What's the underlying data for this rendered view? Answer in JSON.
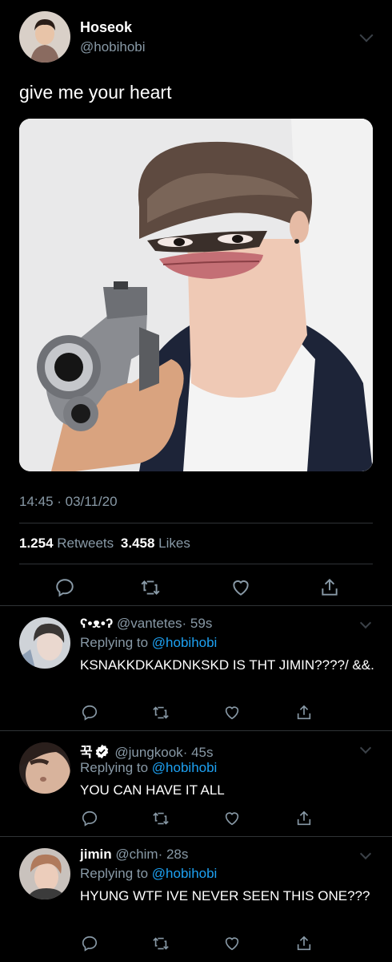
{
  "tweet": {
    "name": "Hoseok",
    "handle": "@hobihobi",
    "text": "give me your heart",
    "timestamp": "14:45 · 03/11/20",
    "retweets_count": "1.254",
    "retweets_label": "Retweets",
    "likes_count": "3.458",
    "likes_label": "Likes"
  },
  "replies": [
    {
      "name": "ʕ•ᴥ•ʔ",
      "handle": "@vantetes",
      "time": "· 59s",
      "replying_prefix": "Replying to",
      "replying_to": "@hobihobi",
      "text": "KSNAKKDKAKDNKSKD IS THT JIMIN????/ &&."
    },
    {
      "name": "꾹",
      "handle": "@jungkook",
      "time": "· 45s",
      "replying_prefix": "Replying to",
      "replying_to": "@hobihobi",
      "text": "YOU CAN HAVE IT ALL"
    },
    {
      "name": "jimin",
      "handle": "@chim",
      "time": "· 28s",
      "replying_prefix": "Replying to",
      "replying_to": "@hobihobi",
      "text": "HYUNG WTF IVE NEVER SEEN THIS ONE???"
    }
  ],
  "icons": [
    "reply-icon",
    "retweet-icon",
    "like-icon",
    "share-icon",
    "chevron-down-icon",
    "verified-badge-icon"
  ],
  "colors": {
    "background": "#000000",
    "muted": "#8899a6",
    "link": "#1da1f2",
    "divider": "#2f3336"
  }
}
